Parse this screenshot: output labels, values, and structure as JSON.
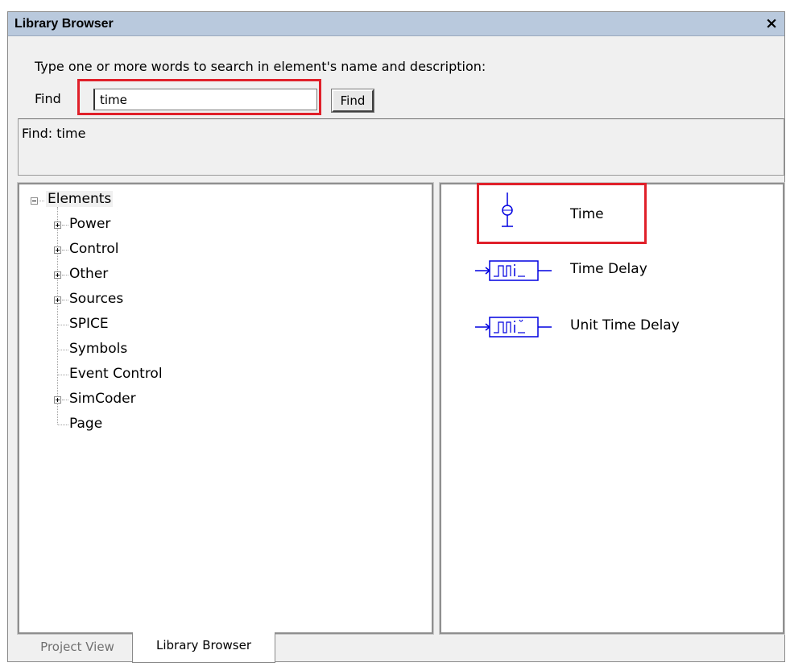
{
  "window": {
    "title": "Library Browser",
    "close_glyph": "×"
  },
  "search": {
    "description": "Type one or more words to search in element's name and  description:",
    "find_label": "Find",
    "query": "time",
    "button_label": "Find",
    "status": "Find: time"
  },
  "tree": {
    "root": "Elements",
    "items": [
      {
        "label": "Power",
        "expandable": true
      },
      {
        "label": "Control",
        "expandable": true
      },
      {
        "label": "Other",
        "expandable": true
      },
      {
        "label": "Sources",
        "expandable": true
      },
      {
        "label": "SPICE",
        "expandable": false
      },
      {
        "label": "Symbols",
        "expandable": false
      },
      {
        "label": "Event Control",
        "expandable": false
      },
      {
        "label": "SimCoder",
        "expandable": true
      },
      {
        "label": "Page",
        "expandable": false
      }
    ]
  },
  "results": [
    {
      "label": "Time",
      "icon": "time-source-icon"
    },
    {
      "label": "Time Delay",
      "icon": "time-delay-block-icon"
    },
    {
      "label": "Unit Time Delay",
      "icon": "unit-time-delay-block-icon"
    }
  ],
  "tabs": [
    {
      "label": "Project View",
      "active": false
    },
    {
      "label": "Library Browser",
      "active": true
    }
  ],
  "colors": {
    "highlight": "#e0202a",
    "symbol": "#0000e0",
    "titlebar": "#b9c9dd"
  }
}
